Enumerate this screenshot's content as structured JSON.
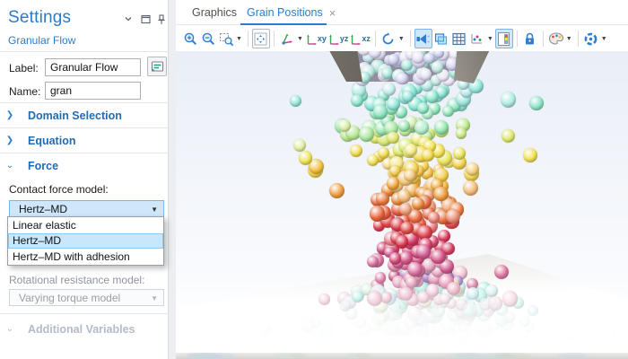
{
  "colors": {
    "accent_blue": "#2b7cd0",
    "header_blue": "#2b7bc9",
    "toolbar_icon_blue": "#2f7fd0",
    "combobox_open_bg": "#cfe7fa",
    "dropdown_highlight_bg": "#c9e6fb",
    "disabled_text": "#9aa0a6"
  },
  "settings_panel": {
    "title": "Settings",
    "subtitle": "Granular Flow",
    "header_icons": [
      "chevron-down",
      "float-window",
      "pin"
    ],
    "fields": {
      "label": {
        "caption": "Label:",
        "value": "Granular Flow"
      },
      "name": {
        "caption": "Name:",
        "value": "gran"
      }
    },
    "sections": {
      "domain_selection": "Domain Selection",
      "equation": "Equation",
      "force": "Force",
      "additional_variables": "Additional Variables"
    },
    "force_section": {
      "contact_force_label": "Contact force model:",
      "contact_force_value": "Hertz–MD",
      "dropdown_open": true,
      "dropdown_options": [
        "Linear elastic",
        "Hertz–MD",
        "Hertz–MD with adhesion"
      ],
      "selected_option": "Hertz–MD",
      "rotational_label": "Rotational resistance model:",
      "rotational_value": "Varying torque model",
      "rotational_disabled": true
    }
  },
  "graphics_window": {
    "tabs": [
      {
        "label": "Graphics",
        "active": false
      },
      {
        "label": "Grain Positions",
        "active": true,
        "closable": true
      }
    ],
    "close_glyph": "×",
    "toolbar_buttons": [
      "zoom-in",
      "zoom-out",
      "zoom-box",
      "zoom-extents",
      "axis-orientation",
      "view-xy",
      "view-yz",
      "view-xz",
      "rotate",
      "scene-light",
      "transparency",
      "grid",
      "axis-small",
      "color-legend",
      "lock",
      "color-palette",
      "snapshot"
    ],
    "view_labels": [
      "xy",
      "yz",
      "xz"
    ]
  },
  "scene": {
    "description": "3D view of colored grains pouring from a gray hopper onto a gray floor plane",
    "seed": 42,
    "funnel_interior_palette": [
      "#d9d5f3",
      "#c6e8ef",
      "#a4e7db",
      "#e4e2f6",
      "#c2ebe5",
      "#ccd0f1",
      "#ede9f8"
    ],
    "column_color_stops": [
      [
        0.0,
        "#dcd8f4"
      ],
      [
        0.1,
        "#c8e9f0"
      ],
      [
        0.18,
        "#86e6d5"
      ],
      [
        0.26,
        "#8fe8b6"
      ],
      [
        0.33,
        "#d6ec74"
      ],
      [
        0.4,
        "#f4e44d"
      ],
      [
        0.48,
        "#f4bc3f"
      ],
      [
        0.56,
        "#ef8a35"
      ],
      [
        0.64,
        "#e8543c"
      ],
      [
        0.72,
        "#dc3052"
      ],
      [
        0.8,
        "#d55a92"
      ],
      [
        0.88,
        "#ec9cba"
      ],
      [
        1.0,
        "#f0c2d4"
      ]
    ],
    "pile_top_palette": [
      "#e2a0c4",
      "#d8739f",
      "#f1ecb6",
      "#f3c3d3",
      "#ad85c9",
      "#c9527f"
    ],
    "pile_palette": [
      "#a2ecde",
      "#c8f3ec",
      "#bfeaf4",
      "#f4ecc9",
      "#eec9d8",
      "#dcf2e6",
      "#e9e5f6",
      "#d3f0ef"
    ],
    "strip_palette": [
      "#bcd8d2",
      "#c3d3e2",
      "#d3cfc2",
      "#c9e0d8"
    ]
  }
}
